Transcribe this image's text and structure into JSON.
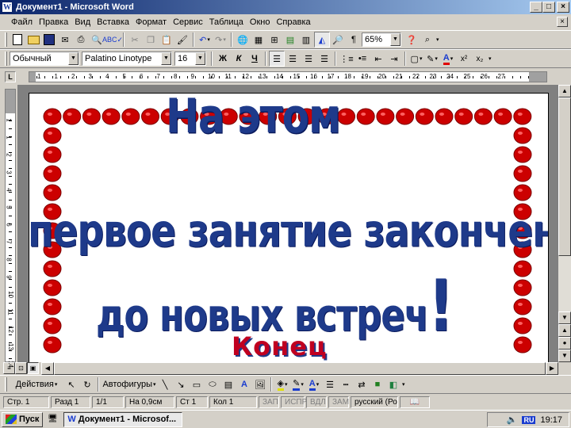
{
  "window": {
    "title": "Документ1 - Microsoft Word",
    "icon_letter": "W",
    "min": "_",
    "max": "□",
    "close": "×"
  },
  "menu": [
    "Файл",
    "Правка",
    "Вид",
    "Вставка",
    "Формат",
    "Сервис",
    "Таблица",
    "Окно",
    "Справка"
  ],
  "menu_close": "×",
  "standard_toolbar": {
    "zoom": "65%"
  },
  "formatting_toolbar": {
    "style": "Обычный",
    "font": "Palatino Linotype",
    "size": "16",
    "bold": "Ж",
    "italic": "К",
    "underline": "Ч"
  },
  "ruler": {
    "corner": "L",
    "numbers": [
      "1",
      "1",
      "2",
      "3",
      "4",
      "5",
      "6",
      "7",
      "8",
      "9",
      "10",
      "11",
      "12",
      "13",
      "14",
      "15",
      "16",
      "17",
      "18",
      "19",
      "20",
      "21",
      "22",
      "23",
      "24",
      "25",
      "26",
      "27"
    ],
    "v_numbers": [
      "1",
      "1",
      "2",
      "3",
      "4",
      "5",
      "6",
      "7",
      "8",
      "9",
      "10",
      "11",
      "12",
      "13",
      "14"
    ]
  },
  "document": {
    "line1": "На этом",
    "line2": "первое занятие закончено",
    "line2_punct": ",",
    "line3": "до новых встреч",
    "line3_punct": "!",
    "footer_word": "Конец"
  },
  "drawing_toolbar": {
    "actions": "Действия",
    "autoshapes": "Автофигуры"
  },
  "status": {
    "page": "Стр.  1",
    "section": "Разд  1",
    "pages": "1/1",
    "at": "На  0,9см",
    "line": "Ст  1",
    "col": "Кол  1",
    "rec": "ЗАП",
    "trk": "ИСПР",
    "ext": "ВДЛ",
    "ovr": "ЗАМ",
    "lang": "русский (Ро"
  },
  "taskbar": {
    "start": "Пуск",
    "task": "Документ1 - Microsof...",
    "lang": "RU",
    "clock": "19:17"
  },
  "colors": {
    "title_blue": "#0a246a",
    "text_blue": "#1e3a8a",
    "berry_red": "#cc0000",
    "konets_red": "#c00020"
  }
}
